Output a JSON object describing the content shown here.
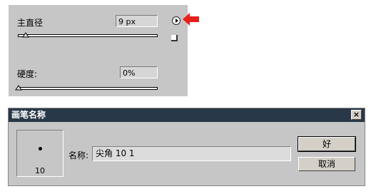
{
  "brush_panel": {
    "diameter_label": "主直径",
    "diameter_value": "9 px",
    "diameter_slider_fraction": 0.03,
    "hardness_label": "硬度:",
    "hardness_value": "0%",
    "hardness_slider_fraction": 0.0,
    "menu_icon": "circle-arrow-right-icon",
    "resize_icon": "resize-corner-icon",
    "pointer_icon": "red-arrow-icon",
    "pointer_color": "#e8201c"
  },
  "dialog": {
    "title": "画笔名称",
    "close_label": "×",
    "preview_size": "10",
    "name_label": "名称:",
    "name_value": "尖角 10 1",
    "ok_label": "好",
    "cancel_label": "取消",
    "titlebar_color": "#283848"
  }
}
